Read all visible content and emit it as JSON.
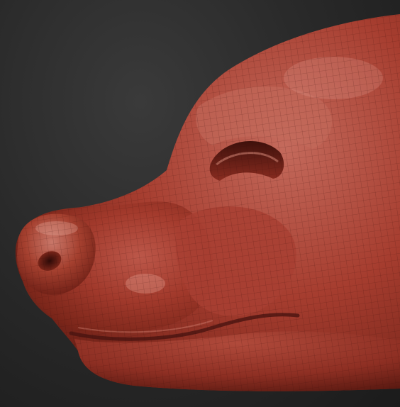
{
  "scene": {
    "subject": "sculpted-animal-snout",
    "material_color": "#a33a2c",
    "highlight_color": "#d98373",
    "shadow_color": "#4a1410",
    "background_color": "#262626",
    "wireframe_visible": true
  }
}
